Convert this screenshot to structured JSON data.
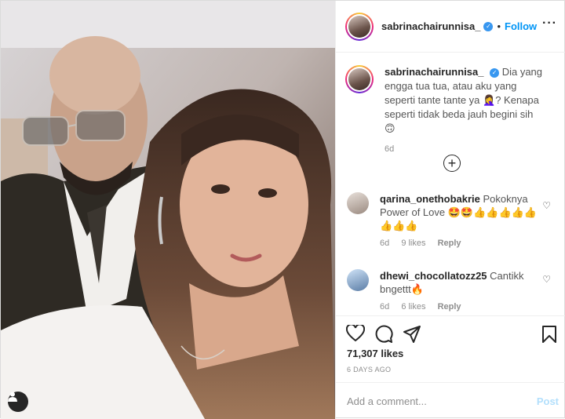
{
  "post": {
    "username": "sabrinachairunnisa_",
    "follow_label": "Follow",
    "caption": "Dia yang engga tua tua, atau aku yang seperti tante tante ya 🤦‍♀️? Kenapa seperti tidak beda jauh begini sih 🙃",
    "caption_time": "6d",
    "likes": "71,307 likes",
    "posted_ago": "6 DAYS AGO",
    "add_comment_placeholder": "Add a comment...",
    "post_label": "Post"
  },
  "comments": [
    {
      "username": "qarina_onethobakrie",
      "text": "Pokoknya Power of Love 🤩🤩👍👍👍👍👍👍👍👍",
      "time": "6d",
      "likes": "9 likes",
      "reply": "Reply"
    },
    {
      "username": "dhewi_chocollatozz25",
      "text": "Cantikk bngettt🔥",
      "time": "6d",
      "likes": "6 likes",
      "reply": "Reply"
    }
  ],
  "icons": {
    "verified": "verified-badge-icon",
    "more": "more-options-icon",
    "like": "heart-icon",
    "comment": "comment-icon",
    "share": "paper-plane-icon",
    "save": "bookmark-icon",
    "load_more": "plus-circle-icon",
    "tag": "user-tag-icon"
  },
  "colors": {
    "link": "#0095f6",
    "muted": "#8e8e8e",
    "verified": "#3897f0"
  }
}
